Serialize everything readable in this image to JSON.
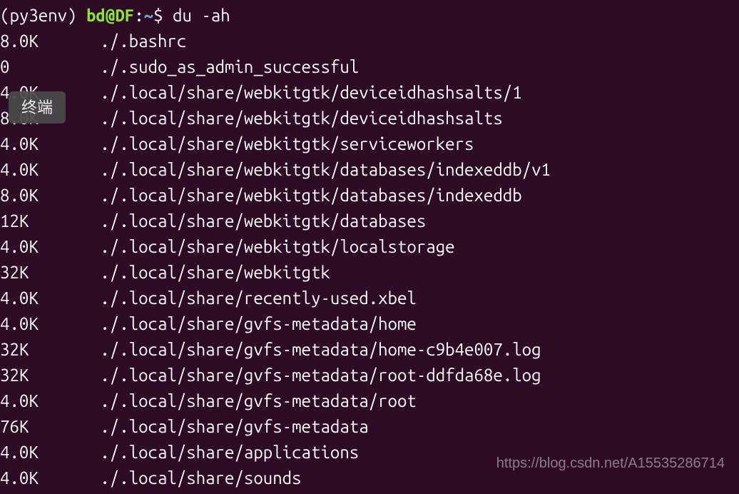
{
  "prompt": {
    "env": "(py3env) ",
    "user": "bd",
    "at": "@",
    "host": "DF",
    "colon": ":",
    "path": "~",
    "dollar": "$ ",
    "command": "du -ah"
  },
  "output": [
    {
      "size": "8.0K",
      "path": "./.bashrc"
    },
    {
      "size": "0",
      "path": "./.sudo_as_admin_successful"
    },
    {
      "size": "4.0K",
      "path": "./.local/share/webkitgtk/deviceidhashsalts/1"
    },
    {
      "size": "8.0K",
      "path": "./.local/share/webkitgtk/deviceidhashsalts"
    },
    {
      "size": "4.0K",
      "path": "./.local/share/webkitgtk/serviceworkers"
    },
    {
      "size": "4.0K",
      "path": "./.local/share/webkitgtk/databases/indexeddb/v1"
    },
    {
      "size": "8.0K",
      "path": "./.local/share/webkitgtk/databases/indexeddb"
    },
    {
      "size": "12K",
      "path": "./.local/share/webkitgtk/databases"
    },
    {
      "size": "4.0K",
      "path": "./.local/share/webkitgtk/localstorage"
    },
    {
      "size": "32K",
      "path": "./.local/share/webkitgtk"
    },
    {
      "size": "4.0K",
      "path": "./.local/share/recently-used.xbel"
    },
    {
      "size": "4.0K",
      "path": "./.local/share/gvfs-metadata/home"
    },
    {
      "size": "32K",
      "path": "./.local/share/gvfs-metadata/home-c9b4e007.log"
    },
    {
      "size": "32K",
      "path": "./.local/share/gvfs-metadata/root-ddfda68e.log"
    },
    {
      "size": "4.0K",
      "path": "./.local/share/gvfs-metadata/root"
    },
    {
      "size": "76K",
      "path": "./.local/share/gvfs-metadata"
    },
    {
      "size": "4.0K",
      "path": "./.local/share/applications"
    },
    {
      "size": "4.0K",
      "path": "./.local/share/sounds"
    }
  ],
  "tooltip": "终端",
  "watermark": "https://blog.csdn.net/A15535286714"
}
